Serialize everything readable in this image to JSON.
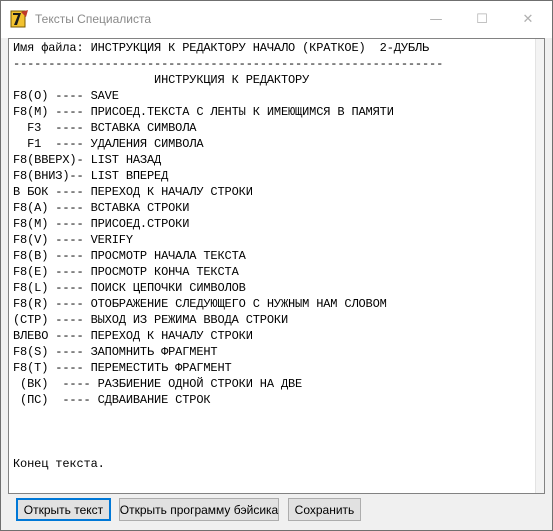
{
  "window": {
    "title": "Тексты Специалиста",
    "minimize": "—",
    "maximize": "☐",
    "close": "✕"
  },
  "editor": {
    "lines": [
      "Имя файла: ИНСТРУКЦИЯ К РЕДАКТОРУ НАЧАЛО (КРАТКОЕ)  2-ДУБЛЬ",
      "-------------------------------------------------------------",
      "                    ИНСТРУКЦИЯ К РЕДАКТОРУ",
      "F8(O) ---- SAVE",
      "F8(M) ---- ПРИСОЕД.ТЕКСТА С ЛЕНТЫ К ИМЕЮЩИМСЯ В ПАМЯТИ",
      "  F3  ---- ВСТАВКА СИМВОЛА",
      "  F1  ---- УДАЛЕНИЯ СИМВОЛА",
      "F8(ВВЕРХ)- LIST НАЗАД",
      "F8(ВНИЗ)-- LIST ВПЕРЕД",
      "В БОК ---- ПЕРЕХОД К НАЧАЛУ СТРОКИ",
      "F8(A) ---- ВСТАВКА СТРОКИ",
      "F8(M) ---- ПРИСОЕД.СТРОКИ",
      "F8(V) ---- VERIFY",
      "F8(B) ---- ПРОСМОТР НАЧАЛА ТЕКСТА",
      "F8(E) ---- ПРОСМОТР КОНЧА ТЕКСТА",
      "F8(L) ---- ПОИСК ЦЕПОЧКИ СИМВОЛОВ",
      "F8(R) ---- ОТОБРАЖЕНИЕ СЛЕДУЮЩЕГО С НУЖНЫМ НАМ СЛОВОМ",
      "(СТР) ---- ВЫХОД ИЗ РЕЖИМА ВВОДА СТРОКИ",
      "ВЛЕВО ---- ПЕРЕХОД К НАЧАЛУ СТРОКИ",
      "F8(S) ---- ЗАПОМНИТЬ ФРАГМЕНТ",
      "F8(T) ---- ПЕРЕМЕСТИТЬ ФРАГМЕНТ",
      " (ВК)  ---- РАЗБИЕНИЕ ОДНОЙ СТРОКИ НА ДВЕ",
      " (ПС)  ---- СДВАИВАНИЕ СТРОК",
      "Конец текста."
    ]
  },
  "buttons": {
    "open_text": "Открыть текст",
    "open_basic": "Открыть программу бэйсика",
    "save": "Сохранить"
  }
}
